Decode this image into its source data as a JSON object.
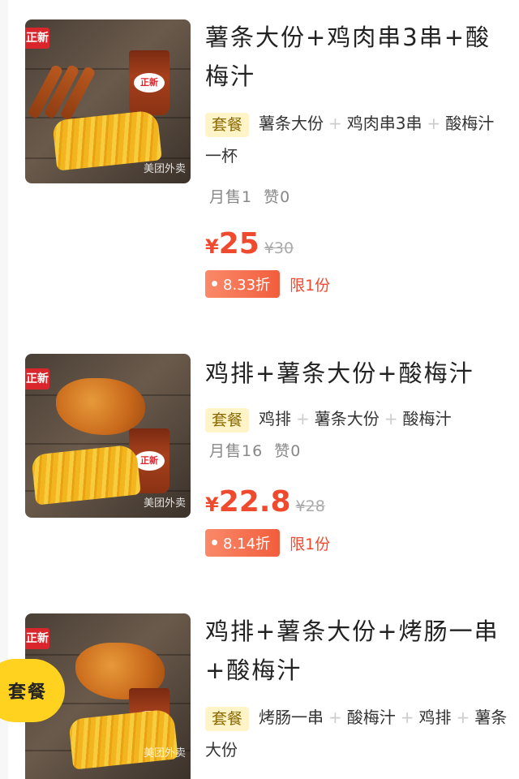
{
  "items": [
    {
      "title": "薯条大份+鸡肉串3串+酸梅汁",
      "tag": "套餐",
      "contents": [
        "薯条大份",
        "鸡肉串3串",
        "酸梅汁一杯"
      ],
      "sales": "月售1",
      "likes": "赞0",
      "currency": "¥",
      "price": "25",
      "original_price": "¥30",
      "discount": "8.33折",
      "limit": "限1份",
      "thumb_brand": "正新",
      "thumb_logo": "正新",
      "thumb_watermark": "美团外卖"
    },
    {
      "title": "鸡排+薯条大份+酸梅汁",
      "tag": "套餐",
      "contents": [
        "鸡排",
        "薯条大份",
        "酸梅汁"
      ],
      "sales": "月售16",
      "likes": "赞0",
      "currency": "¥",
      "price": "22.8",
      "original_price": "¥28",
      "discount": "8.14折",
      "limit": "限1份",
      "thumb_brand": "正新",
      "thumb_logo": "正新",
      "thumb_watermark": "美团外卖"
    },
    {
      "title": "鸡排+薯条大份+烤肠一串+酸梅汁",
      "tag": "套餐",
      "contents": [
        "烤肠一串",
        "酸梅汁",
        "鸡排",
        "薯条大份"
      ],
      "thumb_brand": "正新",
      "thumb_logo": "正新",
      "thumb_watermark": "美团外卖"
    }
  ],
  "floating_category": "套餐",
  "colors": {
    "accent": "#ef4a2e",
    "tag_bg": "#fff3c8",
    "badge": "#ffd21f"
  }
}
